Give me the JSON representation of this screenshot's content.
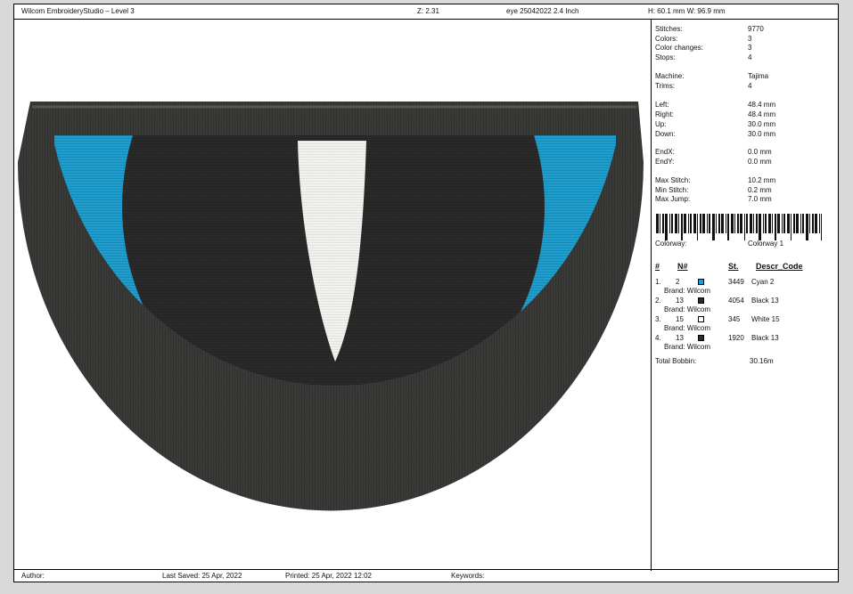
{
  "header": {
    "app_title": "Wilcom EmbroideryStudio – Level 3",
    "zoom": "Z: 2.31",
    "design_name": "eye 25042022 2.4 Inch",
    "size": "H: 60.1 mm   W: 96.9 mm"
  },
  "stats": {
    "stitches_label": "Stitches:",
    "stitches": "9770",
    "colors_label": "Colors:",
    "colors": "3",
    "color_changes_label": "Color changes:",
    "color_changes": "3",
    "stops_label": "Stops:",
    "stops": "4",
    "machine_label": "Machine:",
    "machine": "Tajima",
    "trims_label": "Trims:",
    "trims": "4",
    "left_label": "Left:",
    "left": "48.4 mm",
    "right_label": "Right:",
    "right": "48.4 mm",
    "up_label": "Up:",
    "up": "30.0 mm",
    "down_label": "Down:",
    "down": "30.0 mm",
    "endx_label": "EndX:",
    "endx": "0.0 mm",
    "endy_label": "EndY:",
    "endy": "0.0 mm",
    "max_stitch_label": "Max Stitch:",
    "max_stitch": "10.2 mm",
    "min_stitch_label": "Min Stitch:",
    "min_stitch": "0.2 mm",
    "max_jump_label": "Max Jump:",
    "max_jump": "7.0 mm",
    "colorway_label": "Colorway:",
    "colorway": "Colorway 1"
  },
  "thread_table": {
    "headers": {
      "index": "#",
      "number": "N#",
      "stitches": "St.",
      "descr": "Descr_Code"
    },
    "rows": [
      {
        "index": "1.",
        "number": "2",
        "color": "#1e9fd0",
        "stitches": "3449",
        "descr": "Cyan 2",
        "brand": "Brand: Wilcom"
      },
      {
        "index": "2.",
        "number": "13",
        "color": "#2b2b2b",
        "stitches": "4054",
        "descr": "Black 13",
        "brand": "Brand: Wilcom"
      },
      {
        "index": "3.",
        "number": "15",
        "color": "#ffffff",
        "stitches": "345",
        "descr": "White 15",
        "brand": "Brand: Wilcom"
      },
      {
        "index": "4.",
        "number": "13",
        "color": "#2b2b2b",
        "stitches": "1920",
        "descr": "Black 13",
        "brand": "Brand: Wilcom"
      }
    ],
    "total_bobbin_label": "Total Bobbin:",
    "total_bobbin": "30.16m"
  },
  "footer": {
    "author": "Author:",
    "last_saved": "Last Saved: 25 Apr, 2022",
    "printed": "Printed: 25 Apr, 2022 12:02",
    "keywords": "Keywords:"
  },
  "colors": {
    "cyan": "#1e9fd0",
    "border_black": "#3a3a38",
    "iris_black": "#2a2a2a",
    "pupil_white": "#f2f2ee",
    "page_bg": "#d9d9d9"
  }
}
